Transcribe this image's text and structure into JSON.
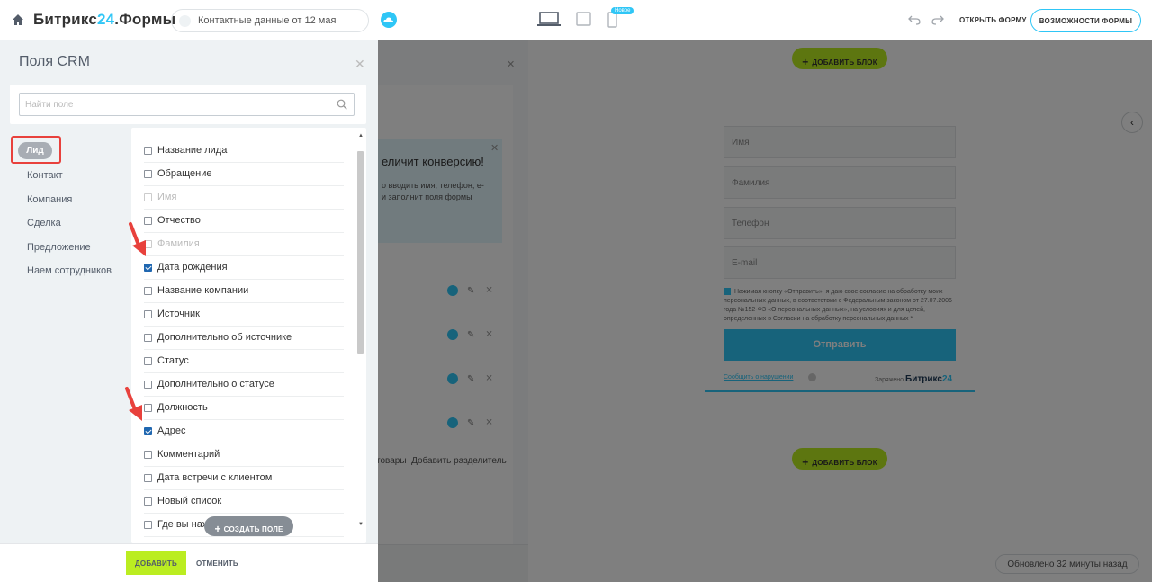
{
  "topbar": {
    "logo_text": "Битрикс",
    "logo_num": "24",
    "logo_suffix": ".Формы",
    "form_name": "Контактные данные от 12 мая",
    "new_badge": "Новое",
    "open_form": "ОТКРЫТЬ ФОРМУ",
    "features": "ВОЗМОЖНОСТИ ФОРМЫ"
  },
  "panel": {
    "title": "Поля CRM",
    "search_placeholder": "Найти поле",
    "categories": [
      "Лид",
      "Контакт",
      "Компания",
      "Сделка",
      "Предложение",
      "Наем сотрудников"
    ],
    "fields": [
      {
        "label": "Название лида",
        "checked": false,
        "disabled": false
      },
      {
        "label": "Обращение",
        "checked": false,
        "disabled": false
      },
      {
        "label": "Имя",
        "checked": false,
        "disabled": true
      },
      {
        "label": "Отчество",
        "checked": false,
        "disabled": false
      },
      {
        "label": "Фамилия",
        "checked": false,
        "disabled": true
      },
      {
        "label": "Дата рождения",
        "checked": true,
        "disabled": false
      },
      {
        "label": "Название компании",
        "checked": false,
        "disabled": false
      },
      {
        "label": "Источник",
        "checked": false,
        "disabled": false
      },
      {
        "label": "Дополнительно об источнике",
        "checked": false,
        "disabled": false
      },
      {
        "label": "Статус",
        "checked": false,
        "disabled": false
      },
      {
        "label": "Дополнительно о статусе",
        "checked": false,
        "disabled": false
      },
      {
        "label": "Должность",
        "checked": false,
        "disabled": false
      },
      {
        "label": "Адрес",
        "checked": true,
        "disabled": false
      },
      {
        "label": "Комментарий",
        "checked": false,
        "disabled": false
      },
      {
        "label": "Дата встречи с клиентом",
        "checked": false,
        "disabled": false
      },
      {
        "label": "Новый список",
        "checked": false,
        "disabled": false
      },
      {
        "label": "Где вы нахо",
        "checked": false,
        "disabled": false
      }
    ],
    "create_field": "СОЗДАТЬ ПОЛЕ",
    "add_button": "ДОБАВИТЬ",
    "cancel_button": "ОТМЕНИТЬ"
  },
  "middle": {
    "promo_title": "еличит конверсию!",
    "promo_text": "о вводить имя, телефон, е-\nи заполнит поля формы",
    "links": "товары  Добавить разделитель"
  },
  "preview": {
    "add_block": "ДОБАВИТЬ БЛОК",
    "fields": [
      "Имя",
      "Фамилия",
      "Телефон",
      "E-mail"
    ],
    "consent": "Нажимая кнопку «Отправить», я даю свое согласие на обработку моих персональных данных, в соответствии с Федеральным законом от 27.07.2006 года №152-ФЗ «О персональных данных», на условиях и для целей, определенных в Согласии на обработку персональных данных *",
    "send": "Отправить",
    "report": "Сообщить о нарушении",
    "powered_prefix": "Заряжено",
    "powered_brand": "Битрикс",
    "powered_num": "24",
    "updated": "Обновлено 32 минуты назад"
  },
  "colors": {
    "accent": "#2fc6f6",
    "lime": "#bbed21",
    "highlight": "#e8413c"
  }
}
